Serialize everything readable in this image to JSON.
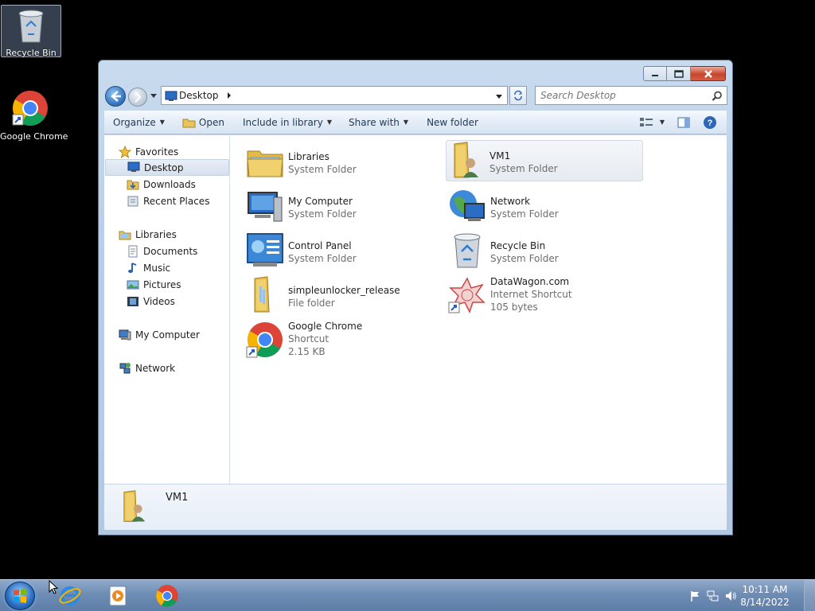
{
  "desktop": {
    "icons": [
      {
        "label": "Recycle Bin",
        "icon": "recycle-bin-icon"
      },
      {
        "label": "Google Chrome",
        "icon": "chrome-icon"
      }
    ]
  },
  "window": {
    "address": {
      "location": "Desktop"
    },
    "search": {
      "placeholder": "Search Desktop"
    },
    "toolbar": {
      "organize": "Organize",
      "open": "Open",
      "include_in_library": "Include in library",
      "share_with": "Share with",
      "new_folder": "New folder"
    },
    "nav": {
      "favorites": "Favorites",
      "desktop": "Desktop",
      "downloads": "Downloads",
      "recent_places": "Recent Places",
      "libraries": "Libraries",
      "documents": "Documents",
      "music": "Music",
      "pictures": "Pictures",
      "videos": "Videos",
      "my_computer": "My Computer",
      "network": "Network"
    },
    "items": [
      {
        "name": "Libraries",
        "type": "System Folder",
        "size": ""
      },
      {
        "name": "VM1",
        "type": "System Folder",
        "size": ""
      },
      {
        "name": "My Computer",
        "type": "System Folder",
        "size": ""
      },
      {
        "name": "Network",
        "type": "System Folder",
        "size": ""
      },
      {
        "name": "Control Panel",
        "type": "System Folder",
        "size": ""
      },
      {
        "name": "Recycle Bin",
        "type": "System Folder",
        "size": ""
      },
      {
        "name": "simpleunlocker_release",
        "type": "File folder",
        "size": ""
      },
      {
        "name": "DataWagon.com",
        "type": "Internet Shortcut",
        "size": "105 bytes"
      },
      {
        "name": "Google Chrome",
        "type": "Shortcut",
        "size": "2.15 KB"
      }
    ],
    "details": {
      "selected_name": "VM1"
    }
  },
  "taskbar": {
    "clock": {
      "time": "10:11 AM",
      "date": "8/14/2022"
    }
  }
}
